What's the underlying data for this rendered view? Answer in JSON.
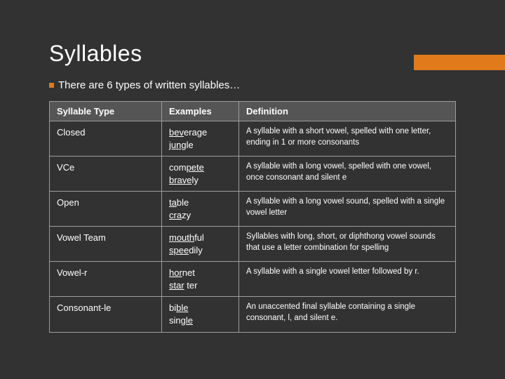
{
  "title": "Syllables",
  "subtitle": "There are 6 types of written syllables…",
  "headers": {
    "type": "Syllable Type",
    "examples": "Examples",
    "definition": "Definition"
  },
  "rows": [
    {
      "type": "Closed",
      "examples": [
        {
          "u": "bev",
          "rest": "erage"
        },
        {
          "u": "jun",
          "rest": "gle"
        }
      ],
      "definition": "A syllable with a short vowel, spelled with one letter, ending in 1 or more consonants"
    },
    {
      "type": "VCe",
      "examples": [
        {
          "pre": "com",
          "u": "pete",
          "rest": ""
        },
        {
          "u": "brave",
          "rest": "ly"
        }
      ],
      "definition": "A syllable with a long vowel, spelled with one vowel, once consonant and silent e"
    },
    {
      "type": "Open",
      "examples": [
        {
          "u": "ta",
          "rest": "ble"
        },
        {
          "u": "cra",
          "rest": "zy"
        }
      ],
      "definition": "A syllable with a long vowel sound, spelled with a single vowel letter"
    },
    {
      "type": "Vowel Team",
      "examples": [
        {
          "u": "mouth",
          "rest": "ful"
        },
        {
          "u": "spee",
          "rest": "dily"
        }
      ],
      "definition": "Syllables with long, short, or diphthong vowel sounds that use a letter combination for spelling"
    },
    {
      "type": "Vowel-r",
      "examples": [
        {
          "u": "hor",
          "rest": "net"
        },
        {
          "u": "star",
          "rest": " ter"
        }
      ],
      "definition": "A syllable with a single vowel letter followed by r."
    },
    {
      "type": "Consonant-le",
      "examples": [
        {
          "pre": "bi",
          "u": "ble",
          "rest": ""
        },
        {
          "pre": "sin",
          "u": "gle",
          "rest": ""
        }
      ],
      "definition": "An unaccented final syllable containing a single consonant, l, and silent e."
    }
  ]
}
